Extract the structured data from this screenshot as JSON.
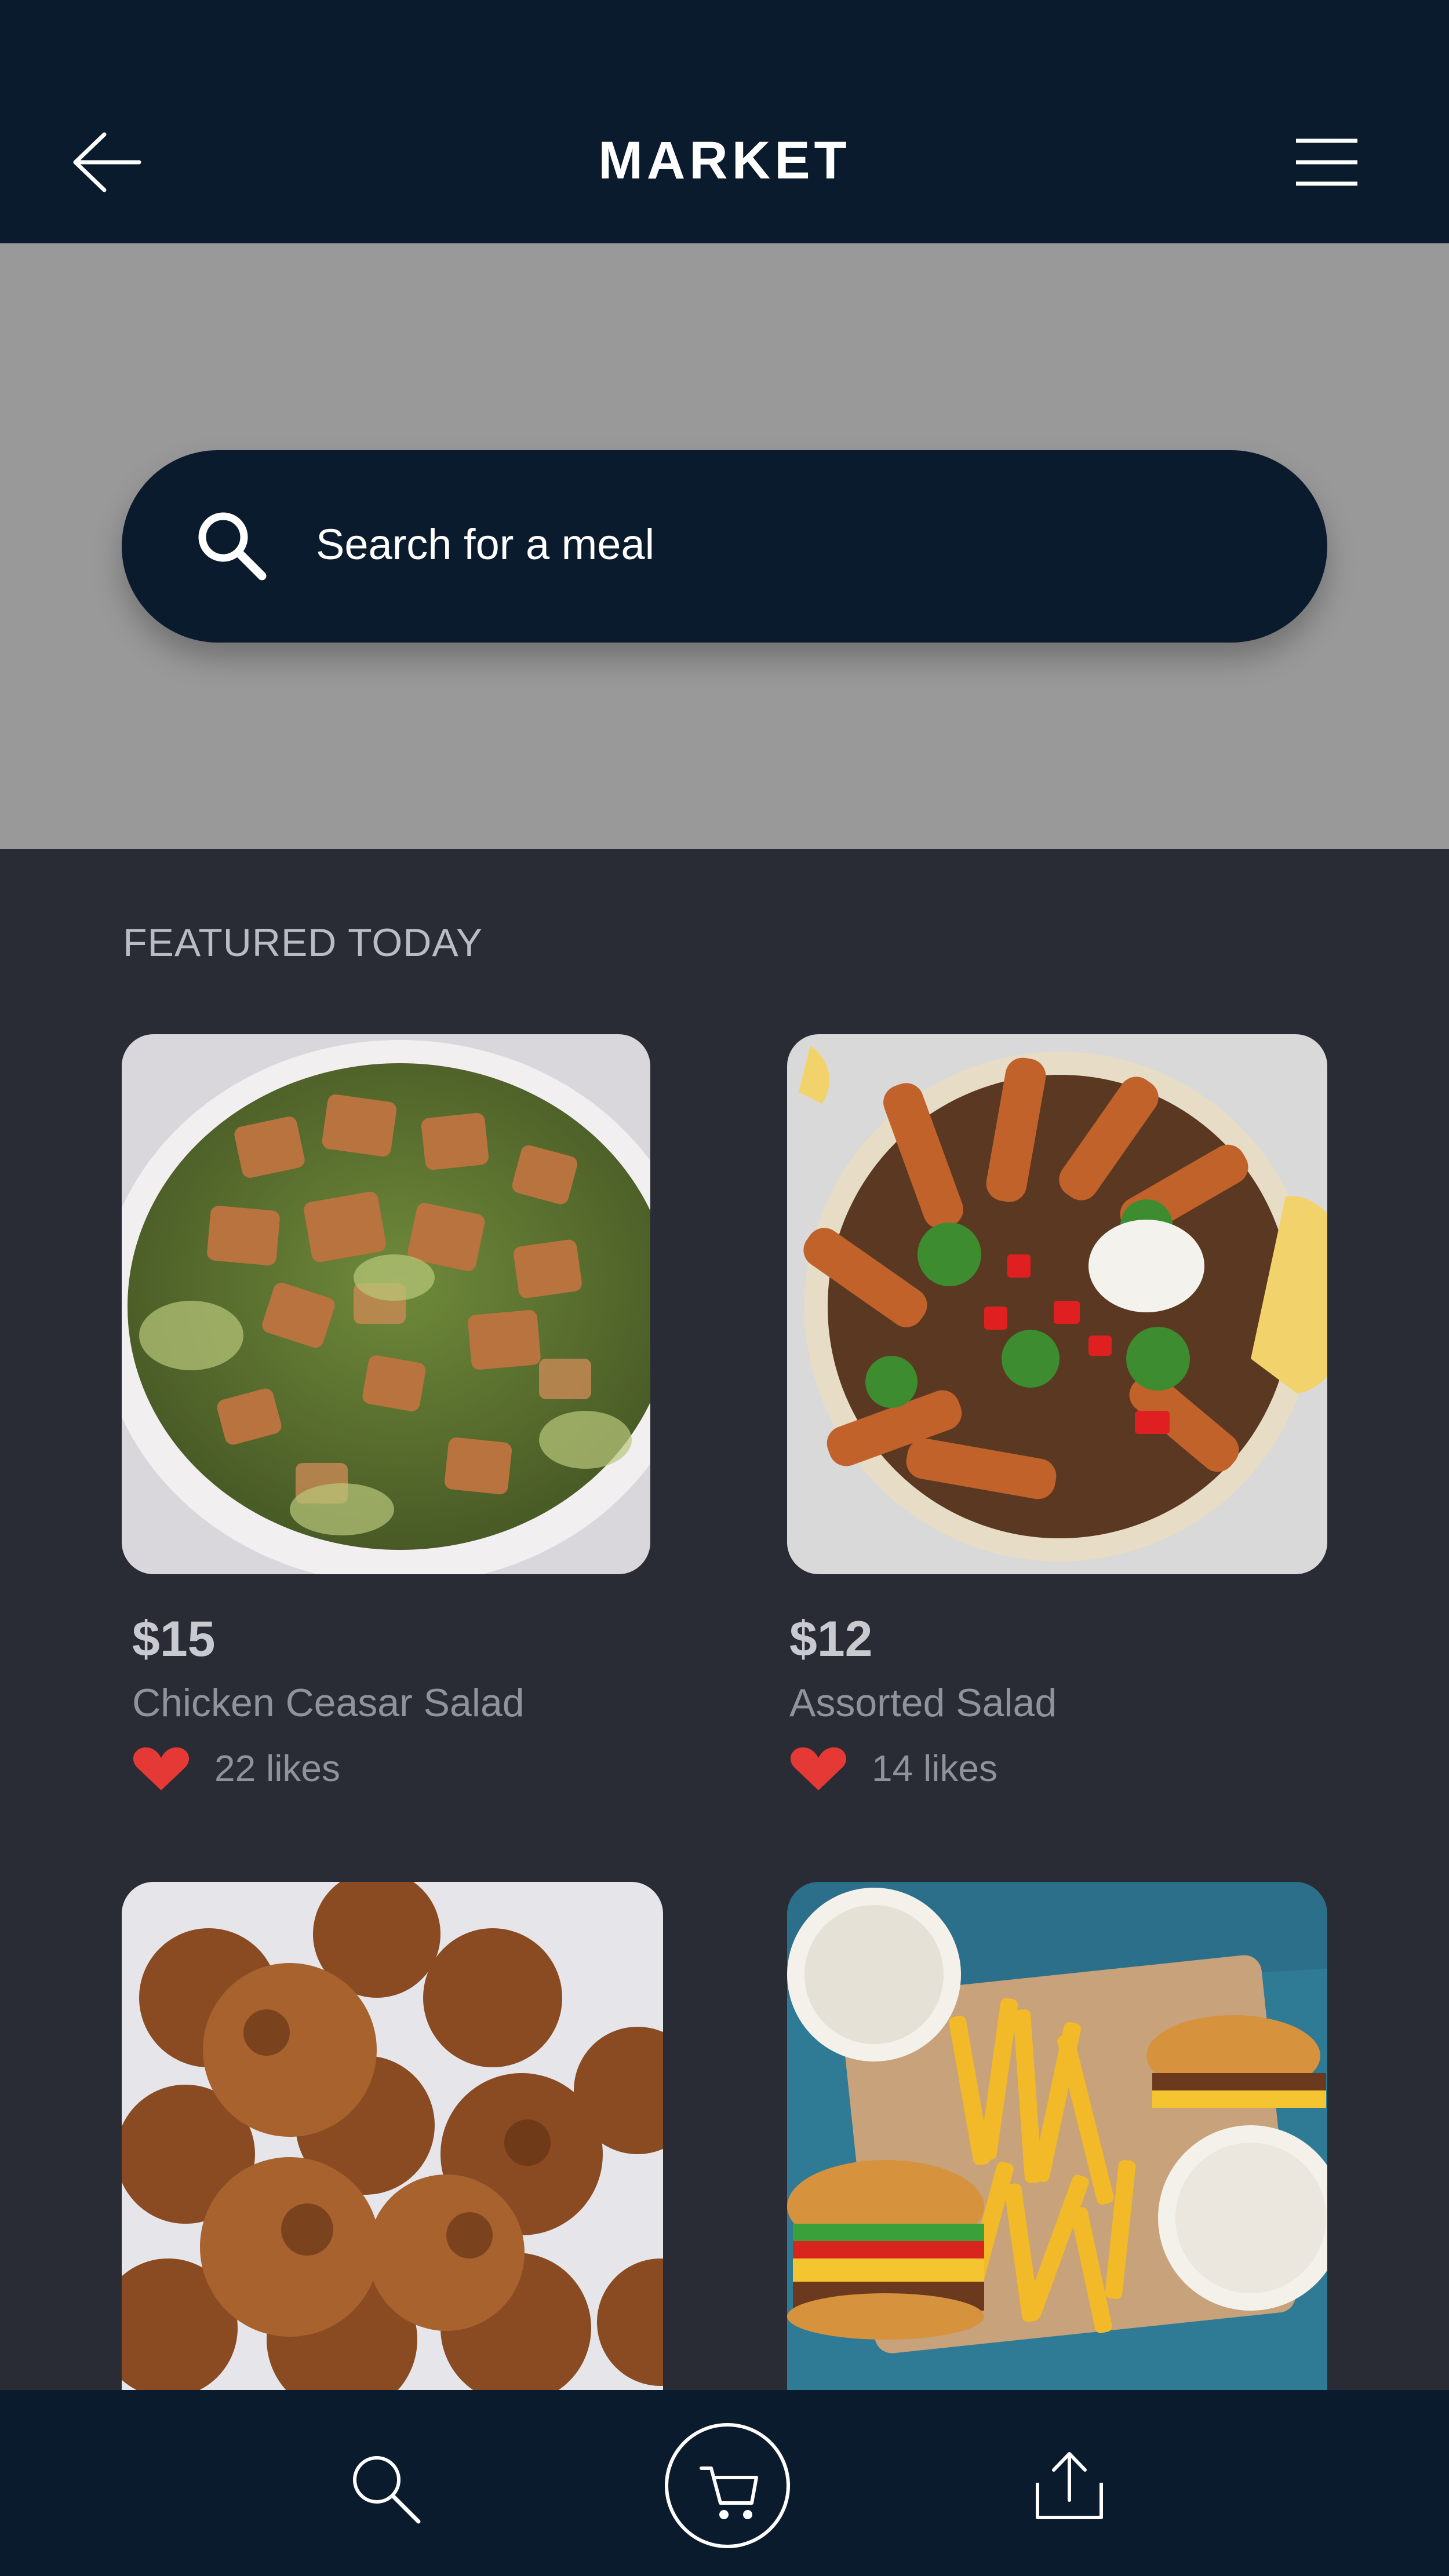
{
  "header": {
    "title": "MARKET",
    "back_icon": "arrow-left-icon",
    "menu_icon": "hamburger-menu-icon"
  },
  "search": {
    "placeholder": "Search for a meal",
    "icon": "search-icon"
  },
  "featured": {
    "title": "FEATURED TODAY",
    "items": [
      {
        "price": "$15",
        "name": "Chicken Ceasar Salad",
        "likes": "22 likes"
      },
      {
        "price": "$12",
        "name": "Assorted Salad",
        "likes": "14 likes"
      },
      {
        "price": "",
        "name": "",
        "likes": ""
      },
      {
        "price": "",
        "name": "",
        "likes": ""
      }
    ]
  },
  "bottom_nav": [
    {
      "icon": "search-icon"
    },
    {
      "icon": "cart-icon"
    },
    {
      "icon": "share-upload-icon"
    }
  ],
  "colors": {
    "navy": "#0b1b2e",
    "dark_background": "#292c35",
    "search_area": "#999999",
    "heart": "#e53935"
  }
}
